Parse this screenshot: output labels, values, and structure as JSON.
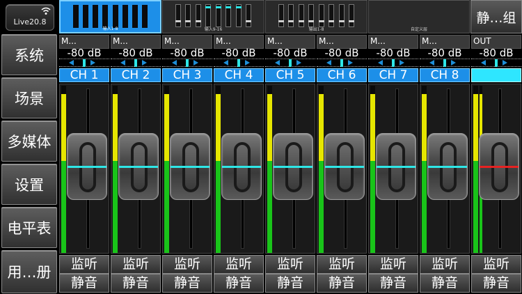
{
  "device": {
    "label": "Live20.8",
    "icon": "wifi-icon"
  },
  "sidebar": {
    "items": [
      {
        "label": "系统"
      },
      {
        "label": "场景"
      },
      {
        "label": "多媒体"
      },
      {
        "label": "设置"
      },
      {
        "label": "电平表"
      },
      {
        "label": "用…册"
      }
    ]
  },
  "tabs": [
    {
      "label": "输入1-8",
      "active": true
    },
    {
      "label": "输入9-16",
      "active": false
    },
    {
      "label": "输出1-8",
      "active": false
    },
    {
      "label": "自定义层",
      "active": false
    }
  ],
  "group_button": {
    "label": "静…组"
  },
  "channels": [
    {
      "name": "M...",
      "gain": "-80 dB",
      "ch": "CH 1",
      "monitor": "监听",
      "mute": "静音",
      "meter_yellow": 0.4,
      "meter_green": 0.55
    },
    {
      "name": "M...",
      "gain": "-80 dB",
      "ch": "CH 2",
      "monitor": "监听",
      "mute": "静音",
      "meter_yellow": 0.4,
      "meter_green": 0.55
    },
    {
      "name": "M...",
      "gain": "-80 dB",
      "ch": "CH 3",
      "monitor": "监听",
      "mute": "静音",
      "meter_yellow": 0.4,
      "meter_green": 0.55
    },
    {
      "name": "M...",
      "gain": "-80 dB",
      "ch": "CH 4",
      "monitor": "监听",
      "mute": "静音",
      "meter_yellow": 0.4,
      "meter_green": 0.55
    },
    {
      "name": "M...",
      "gain": "-80 dB",
      "ch": "CH 5",
      "monitor": "监听",
      "mute": "静音",
      "meter_yellow": 0.4,
      "meter_green": 0.55
    },
    {
      "name": "M...",
      "gain": "-80 dB",
      "ch": "CH 6",
      "monitor": "监听",
      "mute": "静音",
      "meter_yellow": 0.4,
      "meter_green": 0.55
    },
    {
      "name": "M...",
      "gain": "-80 dB",
      "ch": "CH 7",
      "monitor": "监听",
      "mute": "静音",
      "meter_yellow": 0.4,
      "meter_green": 0.55
    },
    {
      "name": "M...",
      "gain": "-80 dB",
      "ch": "CH 8",
      "monitor": "监听",
      "mute": "静音",
      "meter_yellow": 0.4,
      "meter_green": 0.55
    },
    {
      "name": "OUT",
      "gain": "-80 dB",
      "ch": "",
      "monitor": "监听",
      "mute": "静音",
      "meter_yellow": 0.4,
      "meter_green": 0.55,
      "output": true
    }
  ],
  "colors": {
    "accent": "#1d8fe8",
    "fader_line": "#2ee6e6",
    "out_fader_line": "#e62222",
    "meter_yellow": "#e6e600",
    "meter_green": "#19c419"
  }
}
